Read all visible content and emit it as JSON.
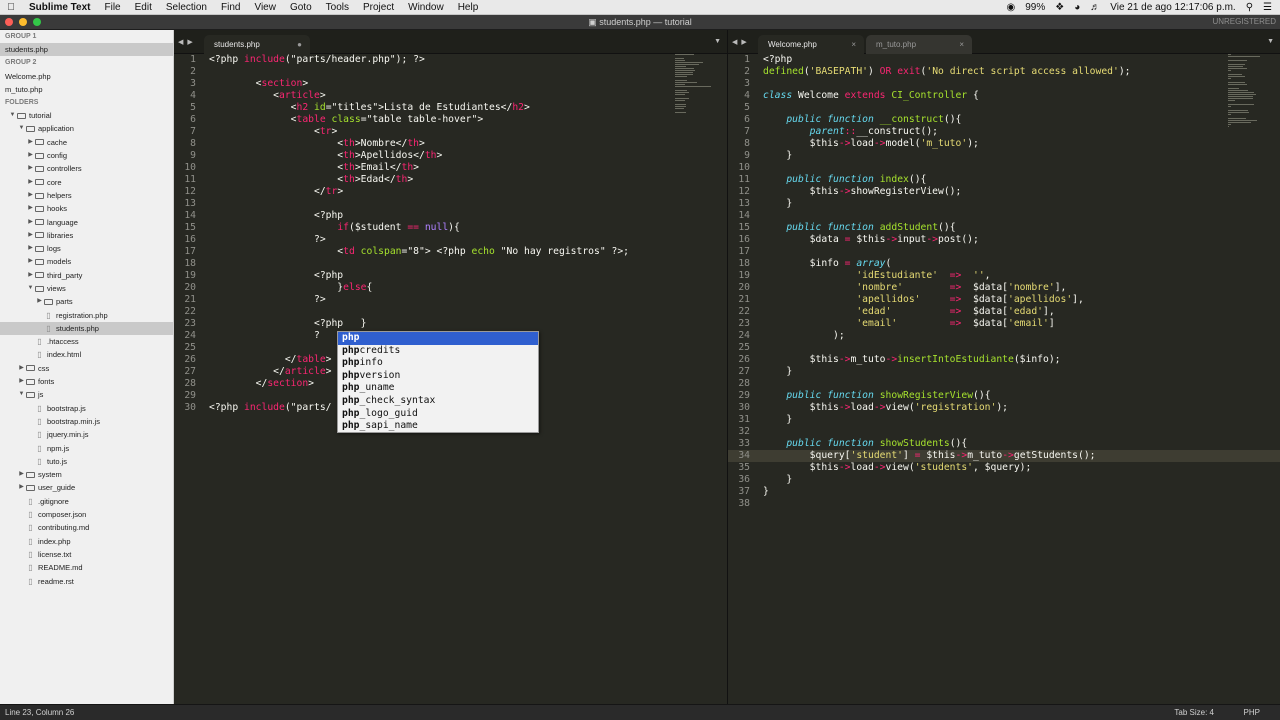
{
  "menubar": {
    "app": "Sublime Text",
    "items": [
      "File",
      "Edit",
      "Selection",
      "Find",
      "View",
      "Goto",
      "Tools",
      "Project",
      "Window",
      "Help"
    ],
    "battery": "99%",
    "datetime": "Vie 21 de ago  12:17:06 p.m."
  },
  "window": {
    "title": "students.php — tutorial",
    "unregistered": "UNREGISTERED"
  },
  "sidebar": {
    "group1": "GROUP 1",
    "group1_file": "students.php",
    "group2": "GROUP 2",
    "group2_files": [
      "Welcome.php",
      "m_tuto.php"
    ],
    "folders_label": "FOLDERS",
    "tree": [
      {
        "label": "tutorial",
        "depth": 0,
        "type": "folder",
        "open": true
      },
      {
        "label": "application",
        "depth": 1,
        "type": "folder",
        "open": true
      },
      {
        "label": "cache",
        "depth": 2,
        "type": "folder",
        "open": false
      },
      {
        "label": "config",
        "depth": 2,
        "type": "folder",
        "open": false
      },
      {
        "label": "controllers",
        "depth": 2,
        "type": "folder",
        "open": false
      },
      {
        "label": "core",
        "depth": 2,
        "type": "folder",
        "open": false
      },
      {
        "label": "helpers",
        "depth": 2,
        "type": "folder",
        "open": false
      },
      {
        "label": "hooks",
        "depth": 2,
        "type": "folder",
        "open": false
      },
      {
        "label": "language",
        "depth": 2,
        "type": "folder",
        "open": false
      },
      {
        "label": "libraries",
        "depth": 2,
        "type": "folder",
        "open": false
      },
      {
        "label": "logs",
        "depth": 2,
        "type": "folder",
        "open": false
      },
      {
        "label": "models",
        "depth": 2,
        "type": "folder",
        "open": false
      },
      {
        "label": "third_party",
        "depth": 2,
        "type": "folder",
        "open": false
      },
      {
        "label": "views",
        "depth": 2,
        "type": "folder",
        "open": true
      },
      {
        "label": "parts",
        "depth": 3,
        "type": "folder",
        "open": false
      },
      {
        "label": "registration.php",
        "depth": 3,
        "type": "file"
      },
      {
        "label": "students.php",
        "depth": 3,
        "type": "file",
        "selected": true
      },
      {
        "label": ".htaccess",
        "depth": 2,
        "type": "file"
      },
      {
        "label": "index.html",
        "depth": 2,
        "type": "file"
      },
      {
        "label": "css",
        "depth": 1,
        "type": "folder",
        "open": false
      },
      {
        "label": "fonts",
        "depth": 1,
        "type": "folder",
        "open": false
      },
      {
        "label": "js",
        "depth": 1,
        "type": "folder",
        "open": true
      },
      {
        "label": "bootstrap.js",
        "depth": 2,
        "type": "file"
      },
      {
        "label": "bootstrap.min.js",
        "depth": 2,
        "type": "file"
      },
      {
        "label": "jquery.min.js",
        "depth": 2,
        "type": "file"
      },
      {
        "label": "npm.js",
        "depth": 2,
        "type": "file"
      },
      {
        "label": "tuto.js",
        "depth": 2,
        "type": "file"
      },
      {
        "label": "system",
        "depth": 1,
        "type": "folder",
        "open": false
      },
      {
        "label": "user_guide",
        "depth": 1,
        "type": "folder",
        "open": false
      },
      {
        "label": ".gitignore",
        "depth": 1,
        "type": "file"
      },
      {
        "label": "composer.json",
        "depth": 1,
        "type": "file"
      },
      {
        "label": "contributing.md",
        "depth": 1,
        "type": "file"
      },
      {
        "label": "index.php",
        "depth": 1,
        "type": "file"
      },
      {
        "label": "license.txt",
        "depth": 1,
        "type": "file"
      },
      {
        "label": "README.md",
        "depth": 1,
        "type": "file"
      },
      {
        "label": "readme.rst",
        "depth": 1,
        "type": "file"
      }
    ]
  },
  "left_pane": {
    "tab": "students.php",
    "lines": [
      [
        [
          "pl",
          "<?php "
        ],
        [
          "kw",
          "include"
        ],
        [
          "pl",
          "(\"parts/header.php\"); ?>"
        ]
      ],
      [],
      [
        [
          "pl",
          "        <"
        ],
        [
          "tg",
          "section"
        ],
        [
          "pl",
          ">"
        ]
      ],
      [
        [
          "pl",
          "           <"
        ],
        [
          "tg",
          "article"
        ],
        [
          "pl",
          ">"
        ]
      ],
      [
        [
          "pl",
          "              <"
        ],
        [
          "tg",
          "h2"
        ],
        [
          "pl",
          " "
        ],
        [
          "at",
          "id"
        ],
        [
          "pl",
          "=\"titles\">Lista de Estudiantes</"
        ],
        [
          "tg",
          "h2"
        ],
        [
          "pl",
          ">"
        ]
      ],
      [
        [
          "pl",
          "              <"
        ],
        [
          "tg",
          "table"
        ],
        [
          "pl",
          " "
        ],
        [
          "at",
          "class"
        ],
        [
          "pl",
          "=\"table table-hover\">"
        ]
      ],
      [
        [
          "pl",
          "                  <"
        ],
        [
          "tg",
          "tr"
        ],
        [
          "pl",
          ">"
        ]
      ],
      [
        [
          "pl",
          "                      <"
        ],
        [
          "tg",
          "th"
        ],
        [
          "pl",
          ">Nombre</"
        ],
        [
          "tg",
          "th"
        ],
        [
          "pl",
          ">"
        ]
      ],
      [
        [
          "pl",
          "                      <"
        ],
        [
          "tg",
          "th"
        ],
        [
          "pl",
          ">Apellidos</"
        ],
        [
          "tg",
          "th"
        ],
        [
          "pl",
          ">"
        ]
      ],
      [
        [
          "pl",
          "                      <"
        ],
        [
          "tg",
          "th"
        ],
        [
          "pl",
          ">Email</"
        ],
        [
          "tg",
          "th"
        ],
        [
          "pl",
          ">"
        ]
      ],
      [
        [
          "pl",
          "                      <"
        ],
        [
          "tg",
          "th"
        ],
        [
          "pl",
          ">Edad</"
        ],
        [
          "tg",
          "th"
        ],
        [
          "pl",
          ">"
        ]
      ],
      [
        [
          "pl",
          "                  </"
        ],
        [
          "tg",
          "tr"
        ],
        [
          "pl",
          ">"
        ]
      ],
      [],
      [
        [
          "pl",
          "                  <?php"
        ]
      ],
      [
        [
          "pl",
          "                      "
        ],
        [
          "kw",
          "if"
        ],
        [
          "pl",
          "($student "
        ],
        [
          "kw",
          "=="
        ],
        [
          "pl",
          " "
        ],
        [
          "ct",
          "null"
        ],
        [
          "pl",
          "){"
        ]
      ],
      [
        [
          "pl",
          "                  ?>"
        ]
      ],
      [
        [
          "pl",
          "                      <"
        ],
        [
          "tg",
          "td"
        ],
        [
          "pl",
          " "
        ],
        [
          "at",
          "colspan"
        ],
        [
          "pl",
          "=\"8\"> <?php "
        ],
        [
          "fn",
          "echo"
        ],
        [
          "pl",
          " \"No hay registros\" ?>;"
        ]
      ],
      [],
      [
        [
          "pl",
          "                  <?php"
        ]
      ],
      [
        [
          "pl",
          "                      }"
        ],
        [
          "kw",
          "else"
        ],
        [
          "pl",
          "{"
        ]
      ],
      [
        [
          "pl",
          "                  ?>"
        ]
      ],
      [],
      [
        [
          "pl",
          "                  <?php   }"
        ]
      ],
      [
        [
          "pl",
          "                  ?"
        ]
      ],
      [],
      [
        [
          "pl",
          "             </"
        ],
        [
          "tg",
          "table"
        ],
        [
          "pl",
          ">"
        ]
      ],
      [
        [
          "pl",
          "           </"
        ],
        [
          "tg",
          "article"
        ],
        [
          "pl",
          ">"
        ]
      ],
      [
        [
          "pl",
          "        </"
        ],
        [
          "tg",
          "section"
        ],
        [
          "pl",
          ">"
        ]
      ],
      [],
      [
        [
          "pl",
          "<?php "
        ],
        [
          "kw",
          "include"
        ],
        [
          "pl",
          "(\"parts/"
        ]
      ]
    ]
  },
  "autocomplete": {
    "typed": "php",
    "items": [
      {
        "prefix": "php",
        "rest": ""
      },
      {
        "prefix": "php",
        "rest": "credits"
      },
      {
        "prefix": "php",
        "rest": "info"
      },
      {
        "prefix": "php",
        "rest": "version"
      },
      {
        "prefix": "php",
        "rest": "_uname"
      },
      {
        "prefix": "php",
        "rest": "_check_syntax"
      },
      {
        "prefix": "php",
        "rest": "_logo_guid"
      },
      {
        "prefix": "php",
        "rest": "_sapi_name"
      }
    ]
  },
  "right_pane": {
    "tabs": [
      "Welcome.php",
      "m_tuto.php"
    ],
    "lines": [
      [
        [
          "pl",
          "<?php"
        ]
      ],
      [
        [
          "fn",
          "defined"
        ],
        [
          "pl",
          "("
        ],
        [
          "st",
          "'BASEPATH'"
        ],
        [
          "pl",
          ") "
        ],
        [
          "kw",
          "OR"
        ],
        [
          "pl",
          " "
        ],
        [
          "kw",
          "exit"
        ],
        [
          "pl",
          "("
        ],
        [
          "st",
          "'No direct script access allowed'"
        ],
        [
          "pl",
          ");"
        ]
      ],
      [],
      [
        [
          "it",
          "class"
        ],
        [
          "pl",
          " Welcome "
        ],
        [
          "kw",
          "extends"
        ],
        [
          "pl",
          " "
        ],
        [
          "at",
          "CI_Controller"
        ],
        [
          "pl",
          " {"
        ]
      ],
      [],
      [
        [
          "pl",
          "    "
        ],
        [
          "it",
          "public"
        ],
        [
          "pl",
          " "
        ],
        [
          "it",
          "function"
        ],
        [
          "pl",
          " "
        ],
        [
          "fn",
          "__construct"
        ],
        [
          "pl",
          "(){"
        ]
      ],
      [
        [
          "pl",
          "        "
        ],
        [
          "it",
          "parent"
        ],
        [
          "kw",
          "::"
        ],
        [
          "pl",
          "__construct();"
        ]
      ],
      [
        [
          "pl",
          "        $this"
        ],
        [
          "kw",
          "->"
        ],
        [
          "pl",
          "load"
        ],
        [
          "kw",
          "->"
        ],
        [
          "pl",
          "model("
        ],
        [
          "st",
          "'m_tuto'"
        ],
        [
          "pl",
          ");"
        ]
      ],
      [
        [
          "pl",
          "    }"
        ]
      ],
      [],
      [
        [
          "pl",
          "    "
        ],
        [
          "it",
          "public"
        ],
        [
          "pl",
          " "
        ],
        [
          "it",
          "function"
        ],
        [
          "pl",
          " "
        ],
        [
          "fn",
          "index"
        ],
        [
          "pl",
          "(){"
        ]
      ],
      [
        [
          "pl",
          "        $this"
        ],
        [
          "kw",
          "->"
        ],
        [
          "pl",
          "showRegisterView();"
        ]
      ],
      [
        [
          "pl",
          "    }"
        ]
      ],
      [],
      [
        [
          "pl",
          "    "
        ],
        [
          "it",
          "public"
        ],
        [
          "pl",
          " "
        ],
        [
          "it",
          "function"
        ],
        [
          "pl",
          " "
        ],
        [
          "fn",
          "addStudent"
        ],
        [
          "pl",
          "(){"
        ]
      ],
      [
        [
          "pl",
          "        $data "
        ],
        [
          "kw",
          "="
        ],
        [
          "pl",
          " $this"
        ],
        [
          "kw",
          "->"
        ],
        [
          "pl",
          "input"
        ],
        [
          "kw",
          "->"
        ],
        [
          "pl",
          "post();"
        ]
      ],
      [],
      [
        [
          "pl",
          "        $info "
        ],
        [
          "kw",
          "="
        ],
        [
          "pl",
          " "
        ],
        [
          "it",
          "array"
        ],
        [
          "pl",
          "("
        ]
      ],
      [
        [
          "pl",
          "                "
        ],
        [
          "st",
          "'idEstudiante'"
        ],
        [
          "pl",
          "  "
        ],
        [
          "kw",
          "=>"
        ],
        [
          "pl",
          "  "
        ],
        [
          "st",
          "''"
        ],
        [
          "pl",
          ","
        ]
      ],
      [
        [
          "pl",
          "                "
        ],
        [
          "st",
          "'nombre'"
        ],
        [
          "pl",
          "        "
        ],
        [
          "kw",
          "=>"
        ],
        [
          "pl",
          "  $data["
        ],
        [
          "st",
          "'nombre'"
        ],
        [
          "pl",
          "],"
        ]
      ],
      [
        [
          "pl",
          "                "
        ],
        [
          "st",
          "'apellidos'"
        ],
        [
          "pl",
          "     "
        ],
        [
          "kw",
          "=>"
        ],
        [
          "pl",
          "  $data["
        ],
        [
          "st",
          "'apellidos'"
        ],
        [
          "pl",
          "],"
        ]
      ],
      [
        [
          "pl",
          "                "
        ],
        [
          "st",
          "'edad'"
        ],
        [
          "pl",
          "          "
        ],
        [
          "kw",
          "=>"
        ],
        [
          "pl",
          "  $data["
        ],
        [
          "st",
          "'edad'"
        ],
        [
          "pl",
          "],"
        ]
      ],
      [
        [
          "pl",
          "                "
        ],
        [
          "st",
          "'email'"
        ],
        [
          "pl",
          "         "
        ],
        [
          "kw",
          "=>"
        ],
        [
          "pl",
          "  $data["
        ],
        [
          "st",
          "'email'"
        ],
        [
          "pl",
          "]"
        ]
      ],
      [
        [
          "pl",
          "            );"
        ]
      ],
      [],
      [
        [
          "pl",
          "        $this"
        ],
        [
          "kw",
          "->"
        ],
        [
          "pl",
          "m_tuto"
        ],
        [
          "kw",
          "->"
        ],
        [
          "fn",
          "insertIntoEstudiante"
        ],
        [
          "pl",
          "($info);"
        ]
      ],
      [
        [
          "pl",
          "    }"
        ]
      ],
      [],
      [
        [
          "pl",
          "    "
        ],
        [
          "it",
          "public"
        ],
        [
          "pl",
          " "
        ],
        [
          "it",
          "function"
        ],
        [
          "pl",
          " "
        ],
        [
          "fn",
          "showRegisterView"
        ],
        [
          "pl",
          "(){"
        ]
      ],
      [
        [
          "pl",
          "        $this"
        ],
        [
          "kw",
          "->"
        ],
        [
          "pl",
          "load"
        ],
        [
          "kw",
          "->"
        ],
        [
          "pl",
          "view("
        ],
        [
          "st",
          "'registration'"
        ],
        [
          "pl",
          ");"
        ]
      ],
      [
        [
          "pl",
          "    }"
        ]
      ],
      [],
      [
        [
          "pl",
          "    "
        ],
        [
          "it",
          "public"
        ],
        [
          "pl",
          " "
        ],
        [
          "it",
          "function"
        ],
        [
          "pl",
          " "
        ],
        [
          "fn",
          "showStudents"
        ],
        [
          "pl",
          "(){"
        ]
      ],
      [
        [
          "pl",
          "        $query["
        ],
        [
          "st",
          "'student'"
        ],
        [
          "pl",
          "] "
        ],
        [
          "kw",
          "="
        ],
        [
          "pl",
          " $this"
        ],
        [
          "kw",
          "->"
        ],
        [
          "pl",
          "m_tuto"
        ],
        [
          "kw",
          "->"
        ],
        [
          "pl",
          "getStudents();"
        ]
      ],
      [
        [
          "pl",
          "        $this"
        ],
        [
          "kw",
          "->"
        ],
        [
          "pl",
          "load"
        ],
        [
          "kw",
          "->"
        ],
        [
          "pl",
          "view("
        ],
        [
          "st",
          "'students'"
        ],
        [
          "pl",
          ", $query);"
        ]
      ],
      [
        [
          "pl",
          "    }"
        ]
      ],
      [
        [
          "pl",
          "}"
        ]
      ],
      []
    ]
  },
  "statusbar": {
    "position": "Line 23, Column 26",
    "tabsize": "Tab Size: 4",
    "syntax": "PHP"
  },
  "colors": {
    "editor_bg": "#272822",
    "keyword": "#f92672",
    "function": "#a6e22e",
    "string": "#e6db74",
    "type": "#66d9ef",
    "selection": "#2f5fcf"
  }
}
